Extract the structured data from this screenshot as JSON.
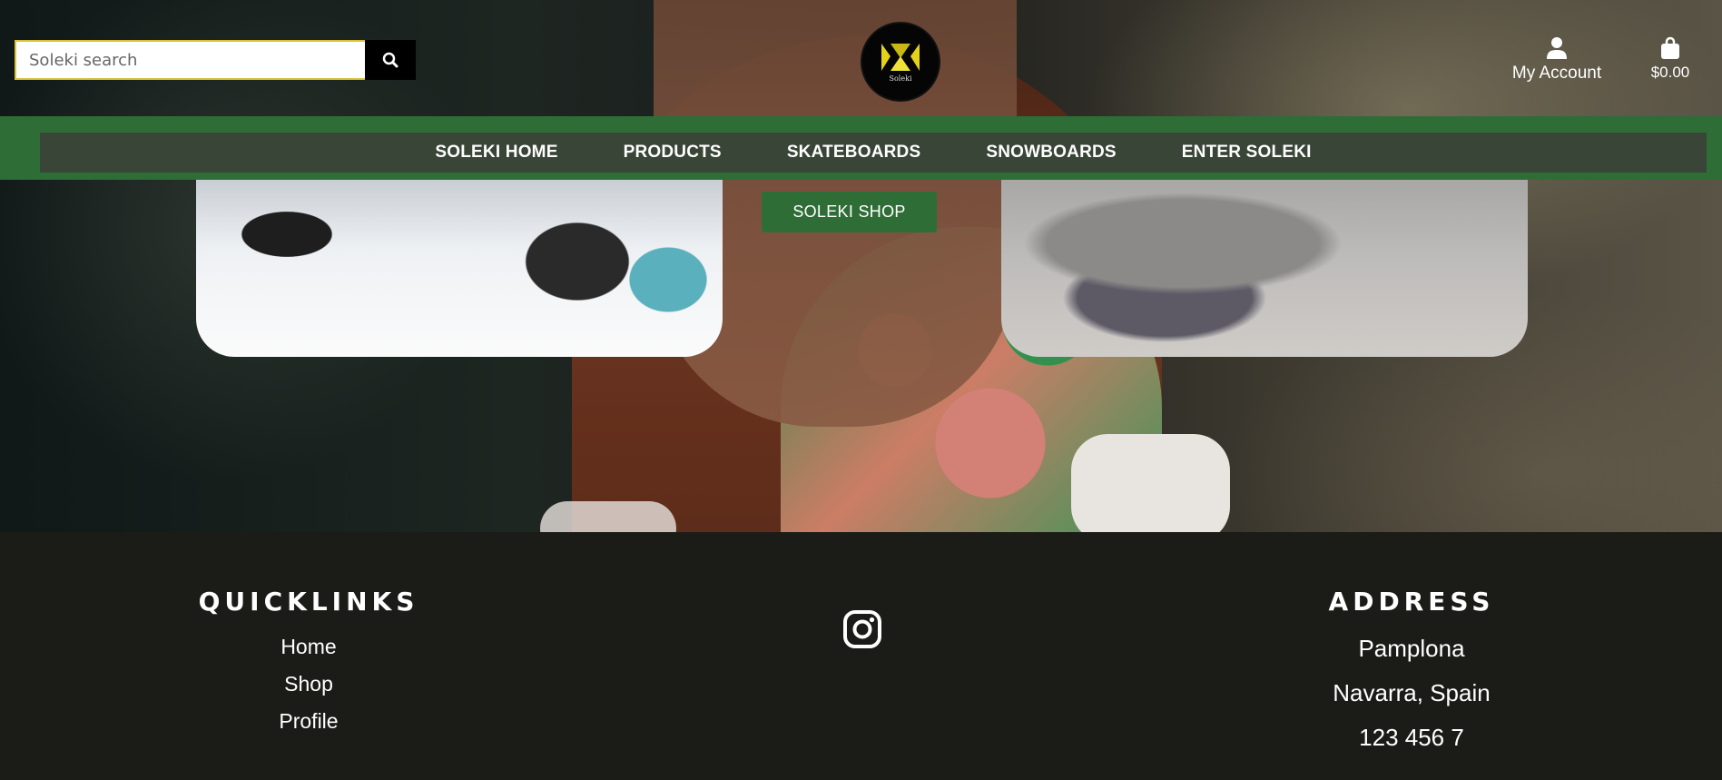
{
  "header": {
    "search_placeholder": "Soleki search",
    "logo_text": "Soleki",
    "account_label": "My Account",
    "cart_total": "$0.00"
  },
  "nav": {
    "items": [
      {
        "label": "SOLEKI HOME"
      },
      {
        "label": "PRODUCTS"
      },
      {
        "label": "SKATEBOARDS"
      },
      {
        "label": "SNOWBOARDS"
      },
      {
        "label": "ENTER SOLEKI"
      }
    ]
  },
  "hero": {
    "shop_button": "SOLEKI SHOP"
  },
  "footer": {
    "quicklinks_title": "QUICKLINKS",
    "quicklinks": [
      "Home",
      "Shop",
      "Profile"
    ],
    "address_title": "ADDRESS",
    "address_lines": [
      "Pamplona",
      "Navarra, Spain",
      "123 456 7"
    ]
  },
  "colors": {
    "accent_green": "#2f6d37",
    "footer_bg": "#1b1b17",
    "search_border": "#d9c23a",
    "logo_yellow": "#e3d11a"
  },
  "icons": {
    "search": "search-icon",
    "account": "user-icon",
    "cart": "shopping-bag-icon",
    "social": "instagram-icon"
  }
}
